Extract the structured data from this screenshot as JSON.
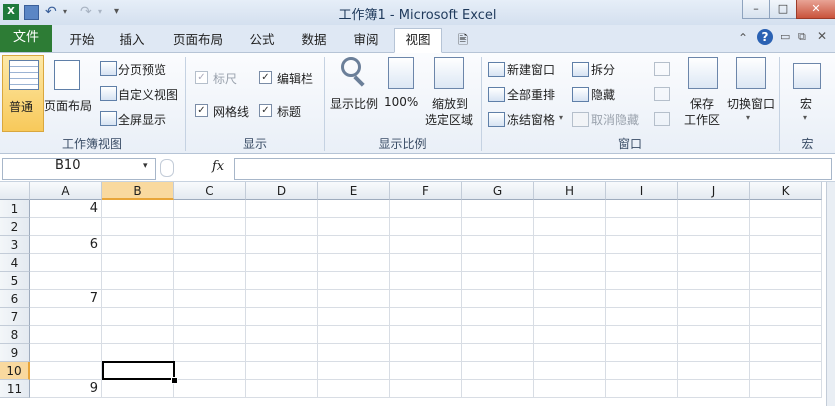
{
  "window": {
    "title": "工作簿1 - Microsoft Excel",
    "controls": [
      "–",
      "□",
      "✕"
    ]
  },
  "tabs": {
    "file": "文件",
    "items": [
      "开始",
      "插入",
      "页面布局",
      "公式",
      "数据",
      "审阅",
      "视图",
      "🖹"
    ],
    "active": "视图"
  },
  "ribbon": {
    "workbook_views": {
      "label": "工作簿视图",
      "normal": "普通",
      "page_layout": "页面布局",
      "page_break": "分页预览",
      "custom_views": "自定义视图",
      "full_screen": "全屏显示"
    },
    "show": {
      "label": "显示",
      "ruler": "标尺",
      "formula_bar": "编辑栏",
      "gridlines": "网格线",
      "headings": "标题"
    },
    "zoom": {
      "label": "显示比例",
      "zoom": "显示比例",
      "zoom_100": "100%",
      "zoom_selection_1": "缩放到",
      "zoom_selection_2": "选定区域"
    },
    "window": {
      "label": "窗口",
      "new_window": "新建窗口",
      "arrange_all": "全部重排",
      "freeze_panes": "冻结窗格",
      "split": "拆分",
      "hide": "隐藏",
      "unhide": "取消隐藏",
      "save_workspace_1": "保存",
      "save_workspace_2": "工作区",
      "switch_windows": "切换窗口"
    },
    "macros": {
      "label": "宏",
      "macros": "宏"
    }
  },
  "formula_bar": {
    "name_box": "B10",
    "fx": "fx",
    "content": ""
  },
  "sheet": {
    "columns": [
      "A",
      "B",
      "C",
      "D",
      "E",
      "F",
      "G",
      "H",
      "I",
      "J",
      "K"
    ],
    "rows": [
      "1",
      "2",
      "3",
      "4",
      "5",
      "6",
      "7",
      "8",
      "9",
      "10",
      "11"
    ],
    "cells": {
      "A1": "4",
      "A3": "6",
      "A6": "7",
      "A11": "9"
    },
    "active_cell": "B10"
  },
  "colors": {
    "file_tab": "#2d7c35",
    "selected_header": "#f9d99f"
  }
}
